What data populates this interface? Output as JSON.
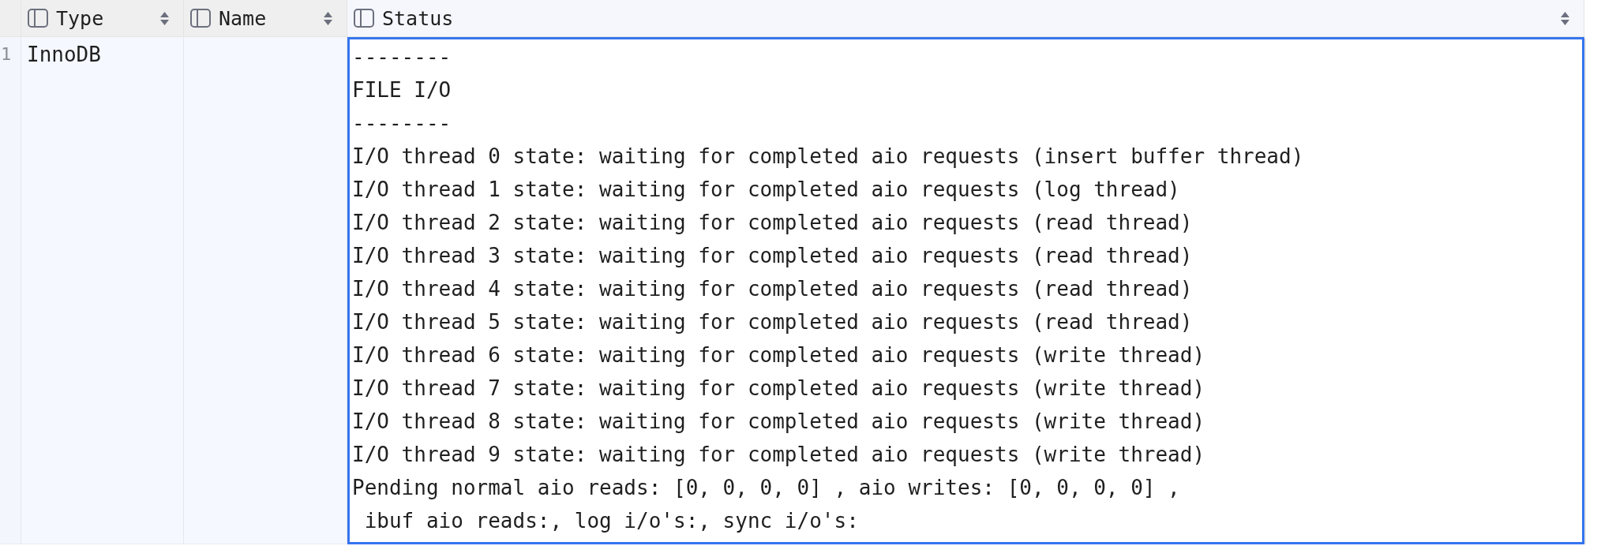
{
  "table": {
    "columns": [
      {
        "label": "Type",
        "selected": false
      },
      {
        "label": "Name",
        "selected": false
      },
      {
        "label": "Status",
        "selected": true
      }
    ],
    "rows": [
      {
        "number": "1",
        "type": "InnoDB",
        "status": {
          "editing": true,
          "lines": [
            "--------",
            "FILE I/O",
            "--------",
            "I/O thread 0 state: waiting for completed aio requests (insert buffer thread)",
            "I/O thread 1 state: waiting for completed aio requests (log thread)",
            "I/O thread 2 state: waiting for completed aio requests (read thread)",
            "I/O thread 3 state: waiting for completed aio requests (read thread)",
            "I/O thread 4 state: waiting for completed aio requests (read thread)",
            "I/O thread 5 state: waiting for completed aio requests (read thread)",
            "I/O thread 6 state: waiting for completed aio requests (write thread)",
            "I/O thread 7 state: waiting for completed aio requests (write thread)",
            "I/O thread 8 state: waiting for completed aio requests (write thread)",
            "I/O thread 9 state: waiting for completed aio requests (write thread)",
            "Pending normal aio reads: [0, 0, 0, 0] , aio writes: [0, 0, 0, 0] ,",
            " ibuf aio reads:, log i/o's:, sync i/o's:"
          ]
        }
      }
    ]
  }
}
